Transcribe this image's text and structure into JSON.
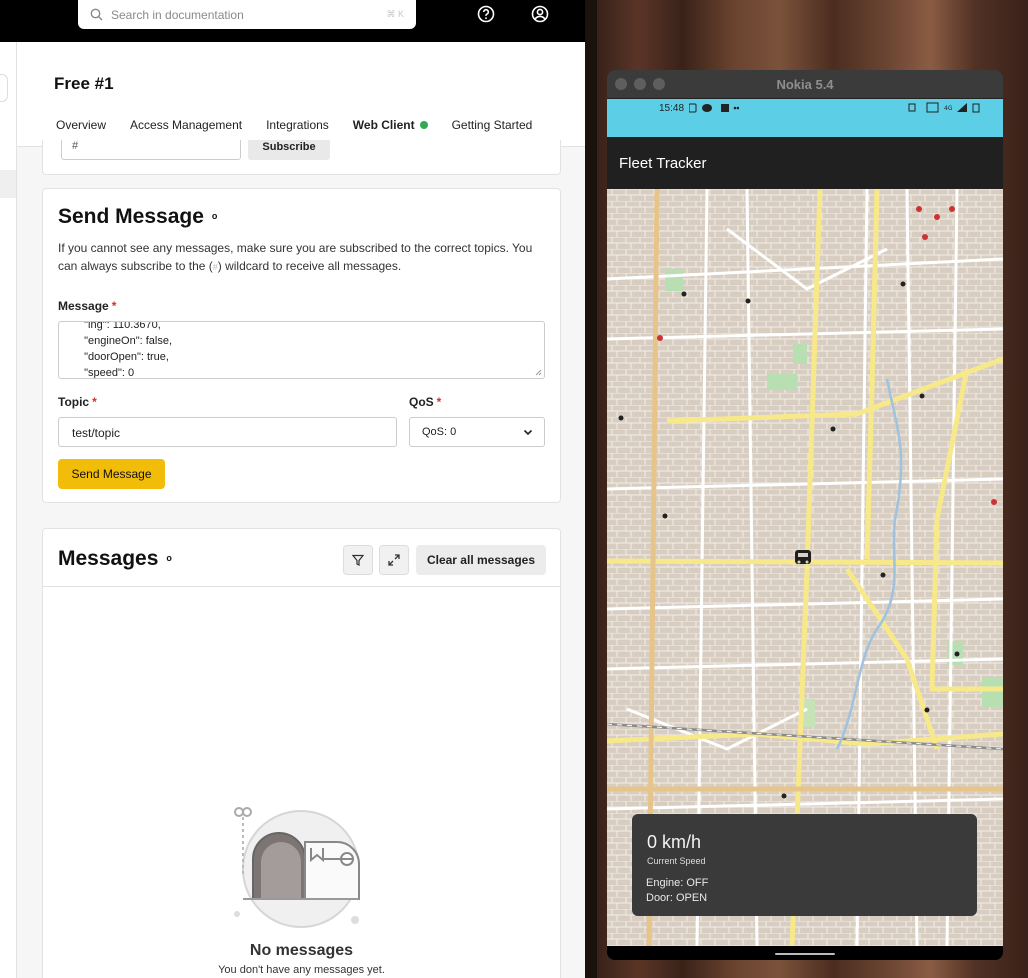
{
  "search": {
    "placeholder": "Search in documentation",
    "shortcut": "⌘ K"
  },
  "topbar": {
    "help_icon": "help-circle-icon",
    "account_icon": "user-circle-icon"
  },
  "page": {
    "title": "Free #1"
  },
  "tabs": [
    {
      "label": "Overview"
    },
    {
      "label": "Access Management"
    },
    {
      "label": "Integrations"
    },
    {
      "label": "Web Client",
      "active": true,
      "status_color": "#34a853"
    },
    {
      "label": "Getting Started"
    }
  ],
  "subscribe": {
    "topic_value": "#",
    "button": "Subscribe"
  },
  "send": {
    "title": "Send Message",
    "description_pre": "If you cannot see any messages, make sure you are subscribed to the correct topics. You can always subscribe to the (",
    "description_wild": "#",
    "description_post": ") wildcard to receive all messages.",
    "message_label": "Message",
    "message_value": "  \"lng\": 110.3670,\n  \"engineOn\": false,\n  \"doorOpen\": true,\n  \"speed\": 0",
    "topic_label": "Topic",
    "topic_value": "test/topic",
    "qos_label": "QoS",
    "qos_value": "QoS: 0",
    "required_mark": "*",
    "button": "Send Message"
  },
  "messages": {
    "title": "Messages",
    "clear_button": "Clear all messages",
    "empty_title": "No messages",
    "empty_subtitle": "You don't have any messages yet."
  },
  "emulator": {
    "window_title": "Nokia 5.4",
    "status_time": "15:48",
    "app_title": "Fleet Tracker",
    "speed": "0 km/h",
    "speed_caption": "Current Speed",
    "engine": "Engine: OFF",
    "door": "Door: OPEN"
  },
  "colors": {
    "accent": "#f1bd08",
    "status_bar": "#5ccfe6",
    "app_bar": "#202020",
    "online_dot": "#34a853"
  }
}
